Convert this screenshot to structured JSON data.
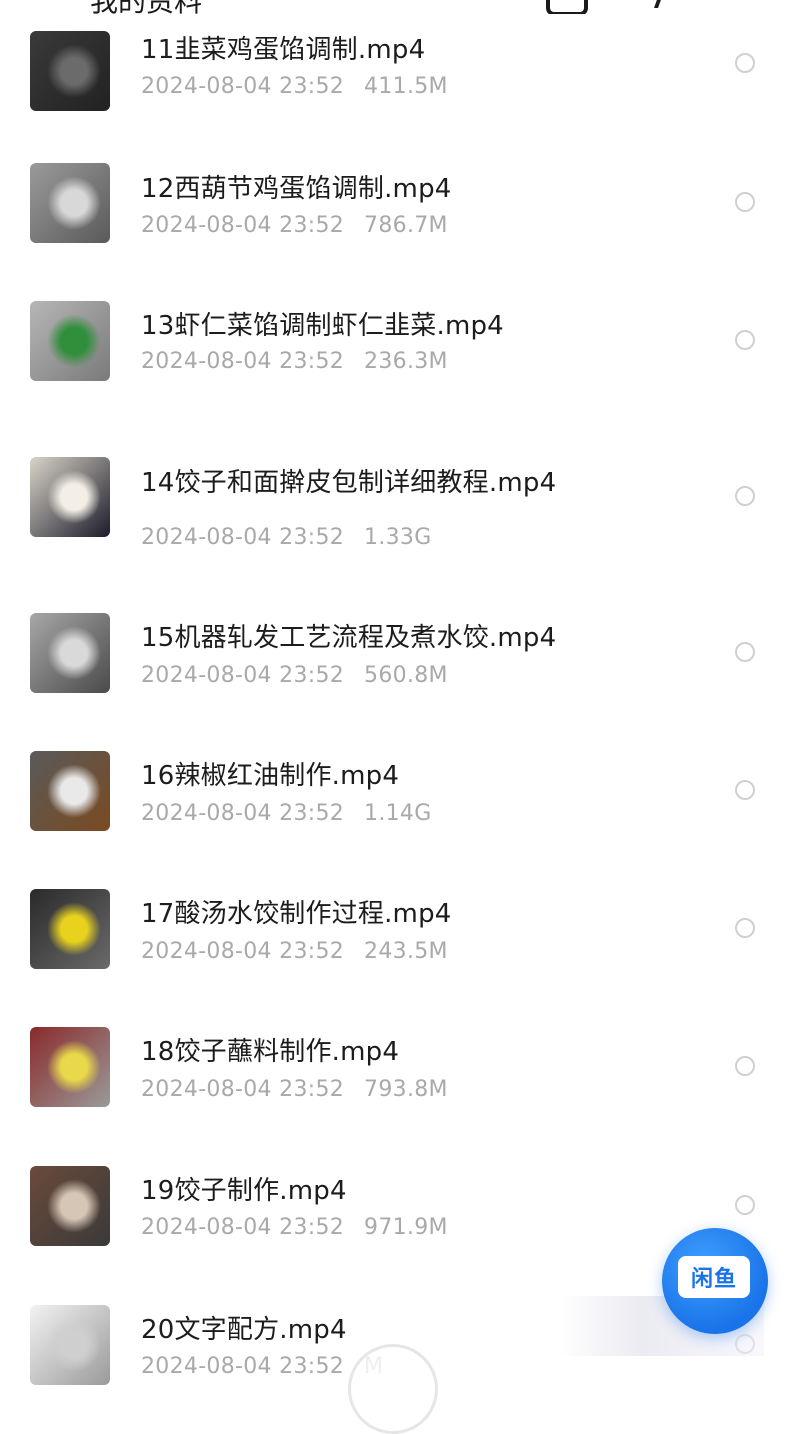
{
  "status_bar": {
    "title": "我的资料"
  },
  "files": [
    {
      "name": "11韭菜鸡蛋馅调制.mp4",
      "date": "2024-08-04 23:52",
      "size": "411.5M",
      "thumb_colors": [
        "#3a3a3a",
        "#6b6b6b",
        "#222222"
      ]
    },
    {
      "name": "12西葫节鸡蛋馅调制.mp4",
      "date": "2024-08-04 23:52",
      "size": "786.7M",
      "thumb_colors": [
        "#9a9a9a",
        "#d8d8d8",
        "#5a5a5a"
      ]
    },
    {
      "name": "13虾仁菜馅调制虾仁韭菜.mp4",
      "date": "2024-08-04 23:52",
      "size": "236.3M",
      "thumb_colors": [
        "#b6b6b6",
        "#2f8f3a",
        "#7a7a7a"
      ]
    },
    {
      "name": "14饺子和面擀皮包制详细教程.mp4",
      "date": "2024-08-04 23:52",
      "size": "1.33G",
      "thumb_colors": [
        "#d9d4c7",
        "#f3efe6",
        "#1b1b2a"
      ]
    },
    {
      "name": "15机器轧发工艺流程及煮水饺.mp4",
      "date": "2024-08-04 23:52",
      "size": "560.8M",
      "thumb_colors": [
        "#a7a7a7",
        "#d9d9d9",
        "#4a4a4a"
      ]
    },
    {
      "name": "16辣椒红油制作.mp4",
      "date": "2024-08-04 23:52",
      "size": "1.14G",
      "thumb_colors": [
        "#5a5a5a",
        "#e9e9e9",
        "#7a4a20"
      ]
    },
    {
      "name": "17酸汤水饺制作过程.mp4",
      "date": "2024-08-04 23:52",
      "size": "243.5M",
      "thumb_colors": [
        "#2a2a2a",
        "#e8d21e",
        "#6a6a6a"
      ]
    },
    {
      "name": "18饺子蘸料制作.mp4",
      "date": "2024-08-04 23:52",
      "size": "793.8M",
      "thumb_colors": [
        "#8a2a2a",
        "#e8d84a",
        "#9a9a9a"
      ]
    },
    {
      "name": "19饺子制作.mp4",
      "date": "2024-08-04 23:52",
      "size": "971.9M",
      "thumb_colors": [
        "#6a4a3a",
        "#d6c6b6",
        "#3a3a3a"
      ]
    },
    {
      "name": "20文字配方.mp4",
      "date": "2024-08-04 23:52",
      "size": "M",
      "thumb_colors": [
        "#f2f2f2",
        "#cfcfcf",
        "#9a9a9a"
      ]
    }
  ],
  "fab": {
    "label": "闲鱼",
    "icon": "xianyu-logo-icon",
    "color": "#1a73e8"
  }
}
